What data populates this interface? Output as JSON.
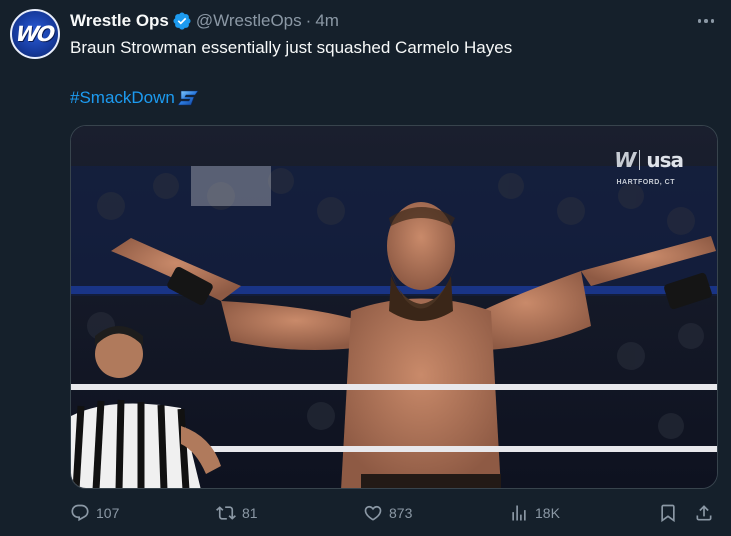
{
  "author": {
    "display_name": "Wrestle Ops",
    "handle": "@WrestleOps",
    "separator": "·",
    "time": "4m",
    "avatar_text": "WO",
    "verified": true
  },
  "tweet": {
    "text": "Braun Strowman essentially just squashed Carmelo Hayes",
    "hashtag": "#SmackDown"
  },
  "media": {
    "broadcast_logo_w": "W",
    "broadcast_logo_network": "usa",
    "location": "HARTFORD, CT"
  },
  "actions": {
    "replies": "107",
    "retweets": "81",
    "likes": "873",
    "views": "18K"
  },
  "colors": {
    "background": "#15202b",
    "text": "#f7f9f9",
    "secondary": "#8b98a5",
    "link": "#1d9bf0",
    "verified": "#1d9bf0"
  },
  "icons": [
    "verified-badge-icon",
    "more-icon",
    "reply-icon",
    "retweet-icon",
    "like-icon",
    "views-icon",
    "bookmark-icon",
    "share-icon"
  ]
}
